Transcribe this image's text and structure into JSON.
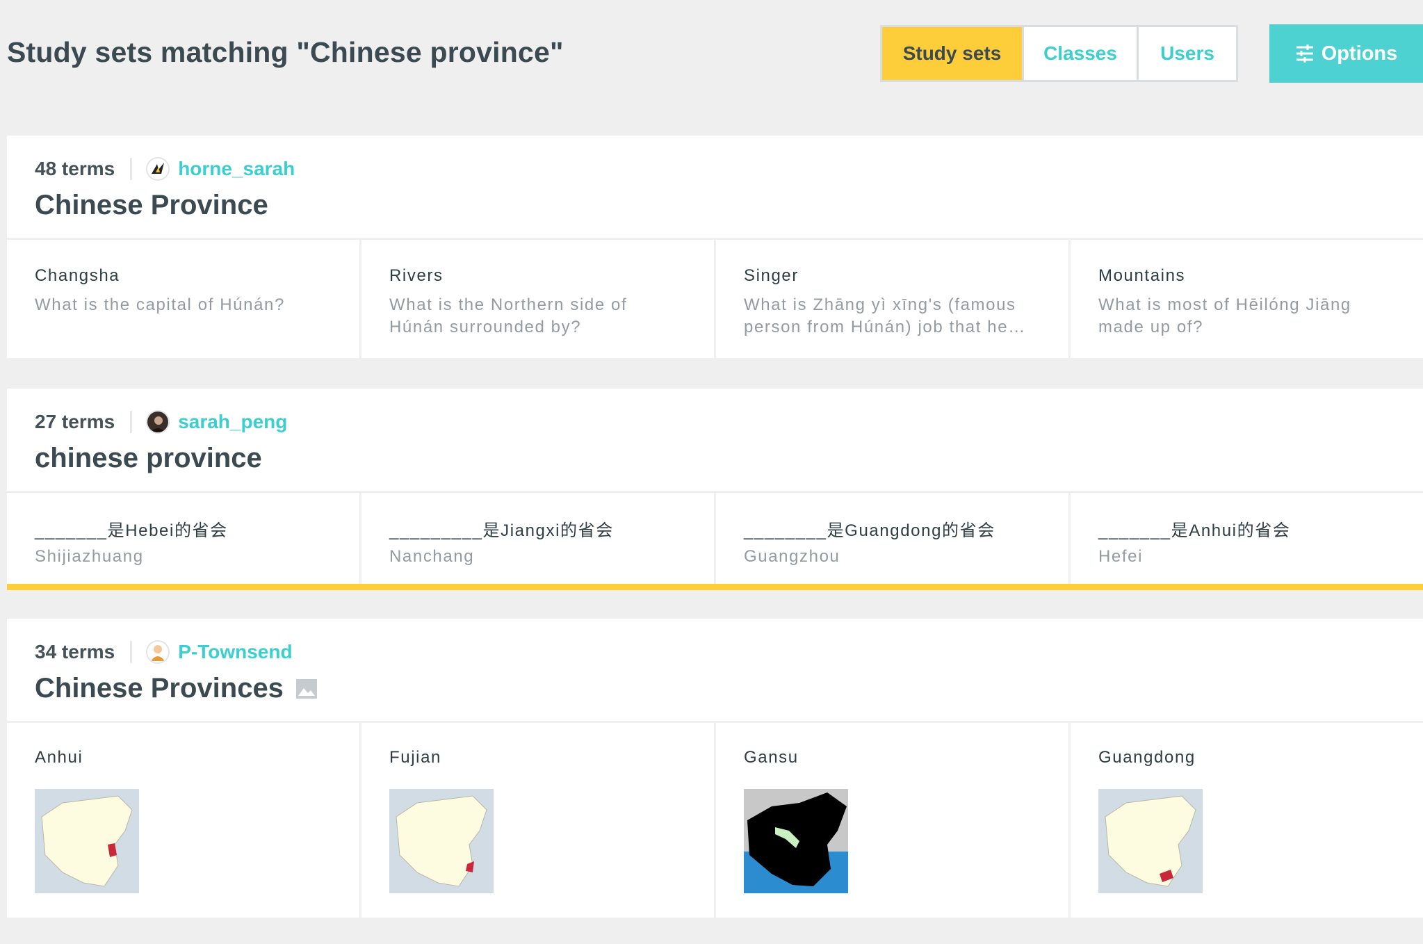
{
  "page": {
    "title": "Study sets matching \"Chinese province\""
  },
  "filters": {
    "tabs": [
      {
        "label": "Study sets",
        "active": true
      },
      {
        "label": "Classes",
        "active": false
      },
      {
        "label": "Users",
        "active": false
      }
    ],
    "options_label": "Options"
  },
  "colors": {
    "accent_teal": "#3ccfcf",
    "accent_yellow": "#fecd3a",
    "map_highlight": "#c8283a"
  },
  "sets": [
    {
      "term_count": "48 terms",
      "username": "horne_sarah",
      "avatar_icon": "bird-avatar-icon",
      "title": "Chinese Province",
      "terms": [
        {
          "word": "Changsha",
          "definition": "What is the capital of Húnán?"
        },
        {
          "word": "Rivers",
          "definition": "What is the Northern side of Húnán surrounded by?"
        },
        {
          "word": "Singer",
          "definition": "What is Zhāng yì xīng's (famous person from Húnán) job that he…"
        },
        {
          "word": "Mountains",
          "definition": "What is most of Hēilóng Jiāng made up of?"
        }
      ]
    },
    {
      "term_count": "27 terms",
      "username": "sarah_peng",
      "avatar_icon": "photo-avatar-icon",
      "title": "chinese province",
      "terms": [
        {
          "word": "_______是Hebei的省会",
          "definition": "Shijiazhuang"
        },
        {
          "word": "_________是Jiangxi的省会",
          "definition": "Nanchang"
        },
        {
          "word": "________是Guangdong的省会",
          "definition": "Guangzhou"
        },
        {
          "word": "_______是Anhui的省会",
          "definition": "Hefei"
        }
      ]
    },
    {
      "term_count": "34 terms",
      "username": "P-Townsend",
      "avatar_icon": "cartoon-avatar-icon",
      "title": "Chinese Provinces",
      "has_image_icon": "image-icon",
      "terms": [
        {
          "word": "Anhui",
          "image": "china-map-anhui-icon"
        },
        {
          "word": "Fujian",
          "image": "china-map-fujian-icon"
        },
        {
          "word": "Gansu",
          "image": "china-map-gansu-icon"
        },
        {
          "word": "Guangdong",
          "image": "china-map-guangdong-icon"
        }
      ]
    }
  ]
}
